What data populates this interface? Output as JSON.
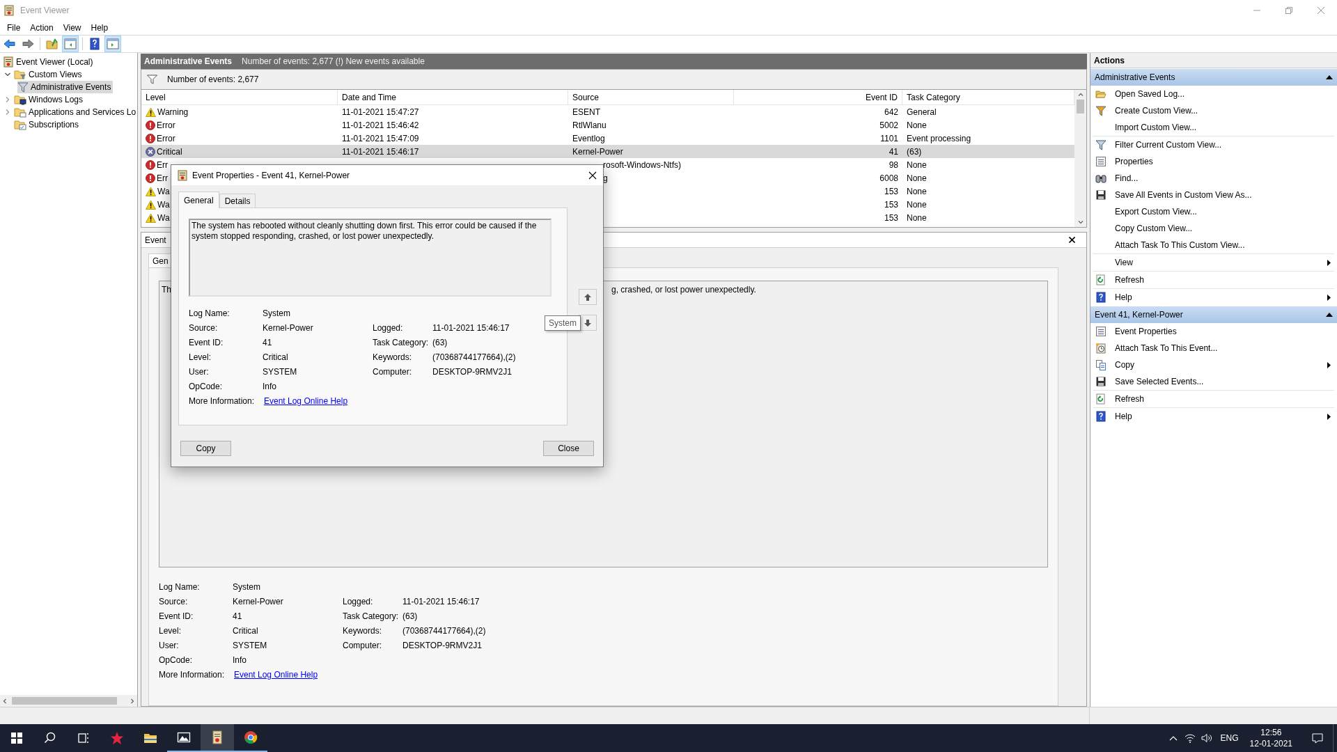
{
  "window": {
    "title": "Event Viewer"
  },
  "menu": [
    "File",
    "Action",
    "View",
    "Help"
  ],
  "toolbar": [
    {
      "kind": "back",
      "on": false
    },
    {
      "kind": "forward",
      "on": false
    },
    {
      "kind": "up",
      "on": false
    },
    {
      "kind": "tree-toggle",
      "on": true
    },
    {
      "kind": "help",
      "on": false
    },
    {
      "kind": "pane-toggle",
      "on": true
    }
  ],
  "tree": [
    {
      "label": "Event Viewer (Local)",
      "kind": "log",
      "selected": false,
      "children": [
        {
          "label": "Custom Views",
          "kind": "filter-folder",
          "expanded": true,
          "selected": false,
          "children": [
            {
              "label": "Administrative Events",
              "kind": "filter",
              "selected": true
            }
          ]
        },
        {
          "label": "Windows Logs",
          "kind": "computer-folder",
          "expanded": false,
          "selected": false
        },
        {
          "label": "Applications and Services Lo",
          "kind": "folder",
          "expanded": false,
          "selected": false
        },
        {
          "label": "Subscriptions",
          "kind": "subscription",
          "selected": false
        }
      ]
    }
  ],
  "main": {
    "title": "Administrative Events",
    "subtitle": "Number of events: 2,677 (!) New events available",
    "filter_text": "Number of events: 2,677"
  },
  "table": {
    "columns": [
      "Level",
      "Date and Time",
      "Source",
      "Event ID",
      "Task Category"
    ],
    "rows": [
      {
        "kind": "warning",
        "level": "Warning",
        "date": "11-01-2021 15:47:27",
        "source": "ESENT",
        "event_id": "642",
        "category": "General",
        "selected": false,
        "covered": false
      },
      {
        "kind": "error",
        "level": "Error",
        "date": "11-01-2021 15:46:42",
        "source": "RtlWlanu",
        "event_id": "5002",
        "category": "None",
        "selected": false,
        "covered": false
      },
      {
        "kind": "error",
        "level": "Error",
        "date": "11-01-2021 15:47:09",
        "source": "Eventlog",
        "event_id": "1101",
        "category": "Event processing",
        "selected": false,
        "covered": false
      },
      {
        "kind": "critical",
        "level": "Critical",
        "date": "11-01-2021 15:46:17",
        "source": "Kernel-Power",
        "event_id": "41",
        "category": "(63)",
        "selected": true,
        "covered": false
      },
      {
        "kind": "error",
        "level": "Err",
        "source": "rosoft-Windows-Ntfs)",
        "event_id": "98",
        "category": "None",
        "selected": false,
        "covered": true
      },
      {
        "kind": "error",
        "level": "Err",
        "source": "g",
        "event_id": "6008",
        "category": "None",
        "selected": false,
        "covered": true
      },
      {
        "kind": "warning",
        "level": "Wa",
        "event_id": "153",
        "category": "None",
        "selected": false
      },
      {
        "kind": "warning",
        "level": "Wa",
        "event_id": "153",
        "category": "None",
        "selected": false
      },
      {
        "kind": "warning",
        "level": "Wa",
        "event_id": "153",
        "category": "None",
        "selected": false
      }
    ]
  },
  "details_pane": {
    "title": "Event",
    "tab": "Gen",
    "message_parts": [
      "Th",
      "g, crashed, or lost power unexpectedly."
    ],
    "fields_left": [
      {
        "label": "Log Name:",
        "value": "System"
      },
      {
        "label": "Source:",
        "value": "Kernel-Power"
      },
      {
        "label": "Event ID:",
        "value": "41"
      },
      {
        "label": "Level:",
        "value": "Critical"
      },
      {
        "label": "User:",
        "value": "SYSTEM"
      },
      {
        "label": "OpCode:",
        "value": "Info"
      }
    ],
    "fields_right": [
      {
        "label": "Logged:",
        "value": "11-01-2021 15:46:17"
      },
      {
        "label": "Task Category:",
        "value": "(63)"
      },
      {
        "label": "Keywords:",
        "value": "(70368744177664),(2)"
      },
      {
        "label": "Computer:",
        "value": "DESKTOP-9RMV2J1"
      }
    ],
    "more_info": {
      "label": "More Information:",
      "link": "Event Log Online Help"
    }
  },
  "dialog": {
    "title": "Event Properties - Event 41, Kernel-Power",
    "tabs": [
      {
        "label": "General",
        "selected": true
      },
      {
        "label": "Details",
        "selected": false
      }
    ],
    "message": "The system has rebooted without cleanly shutting down first. This error could be caused if the system stopped responding, crashed, or lost power unexpectedly.",
    "fields_left": [
      {
        "label": "Log Name:",
        "value": "System"
      },
      {
        "label": "Source:",
        "value": "Kernel-Power"
      },
      {
        "label": "Event ID:",
        "value": "41"
      },
      {
        "label": "Level:",
        "value": "Critical"
      },
      {
        "label": "User:",
        "value": "SYSTEM"
      },
      {
        "label": "OpCode:",
        "value": "Info"
      }
    ],
    "fields_right": [
      {
        "label": "Logged:",
        "value": "11-01-2021 15:46:17"
      },
      {
        "label": "Task Category:",
        "value": "(63)"
      },
      {
        "label": "Keywords:",
        "value": "(70368744177664),(2)"
      },
      {
        "label": "Computer:",
        "value": "DESKTOP-9RMV2J1"
      }
    ],
    "more_info": {
      "label": "More Information:",
      "link": "Event Log Online Help"
    },
    "tooltip": "System",
    "buttons": [
      "Copy",
      "Close"
    ]
  },
  "actions": {
    "title": "Actions",
    "sections": [
      {
        "title": "Administrative Events",
        "expanded": true,
        "groups": [
          [
            {
              "label": "Open Saved Log...",
              "kind": "open",
              "submenu": false
            },
            {
              "label": "Create Custom View...",
              "kind": "create-filter",
              "submenu": false
            },
            {
              "label": "Import Custom View...",
              "kind": "none",
              "submenu": false
            }
          ],
          [
            {
              "label": "Filter Current Custom View...",
              "kind": "filter",
              "submenu": false
            },
            {
              "label": "Properties",
              "kind": "properties",
              "submenu": false
            },
            {
              "label": "Find...",
              "kind": "find",
              "submenu": false
            },
            {
              "label": "Save All Events in Custom View As...",
              "kind": "save",
              "submenu": false
            },
            {
              "label": "Export Custom View...",
              "kind": "none",
              "submenu": false
            },
            {
              "label": "Copy Custom View...",
              "kind": "none",
              "submenu": false
            },
            {
              "label": "Attach Task To This Custom View...",
              "kind": "none",
              "submenu": false
            }
          ],
          [
            {
              "label": "View",
              "kind": "none",
              "submenu": true
            }
          ],
          [
            {
              "label": "Refresh",
              "kind": "refresh",
              "submenu": false
            }
          ],
          [
            {
              "label": "Help",
              "kind": "help",
              "submenu": true
            }
          ]
        ]
      },
      {
        "title": "Event 41, Kernel-Power",
        "expanded": true,
        "groups": [
          [
            {
              "label": "Event Properties",
              "kind": "properties",
              "submenu": false
            },
            {
              "label": "Attach Task To This Event...",
              "kind": "task",
              "submenu": false
            },
            {
              "label": "Copy",
              "kind": "copy",
              "submenu": true
            },
            {
              "label": "Save Selected Events...",
              "kind": "save",
              "submenu": false
            }
          ],
          [
            {
              "label": "Refresh",
              "kind": "refresh",
              "submenu": false
            }
          ],
          [
            {
              "label": "Help",
              "kind": "help",
              "submenu": true
            }
          ]
        ]
      }
    ]
  },
  "taskbar": {
    "apps": [
      {
        "kind": "start",
        "open": false,
        "active": false
      },
      {
        "kind": "search",
        "open": false,
        "active": false
      },
      {
        "kind": "task-view",
        "open": false,
        "active": false
      },
      {
        "kind": "red-app",
        "open": false,
        "active": false
      },
      {
        "kind": "folder",
        "open": false,
        "active": false
      },
      {
        "kind": "photos",
        "open": true,
        "active": false
      },
      {
        "kind": "event-viewer",
        "open": true,
        "active": true
      },
      {
        "kind": "chrome",
        "open": true,
        "active": false
      }
    ],
    "language": "ENG",
    "time": "12:56",
    "date": "12-01-2021"
  }
}
